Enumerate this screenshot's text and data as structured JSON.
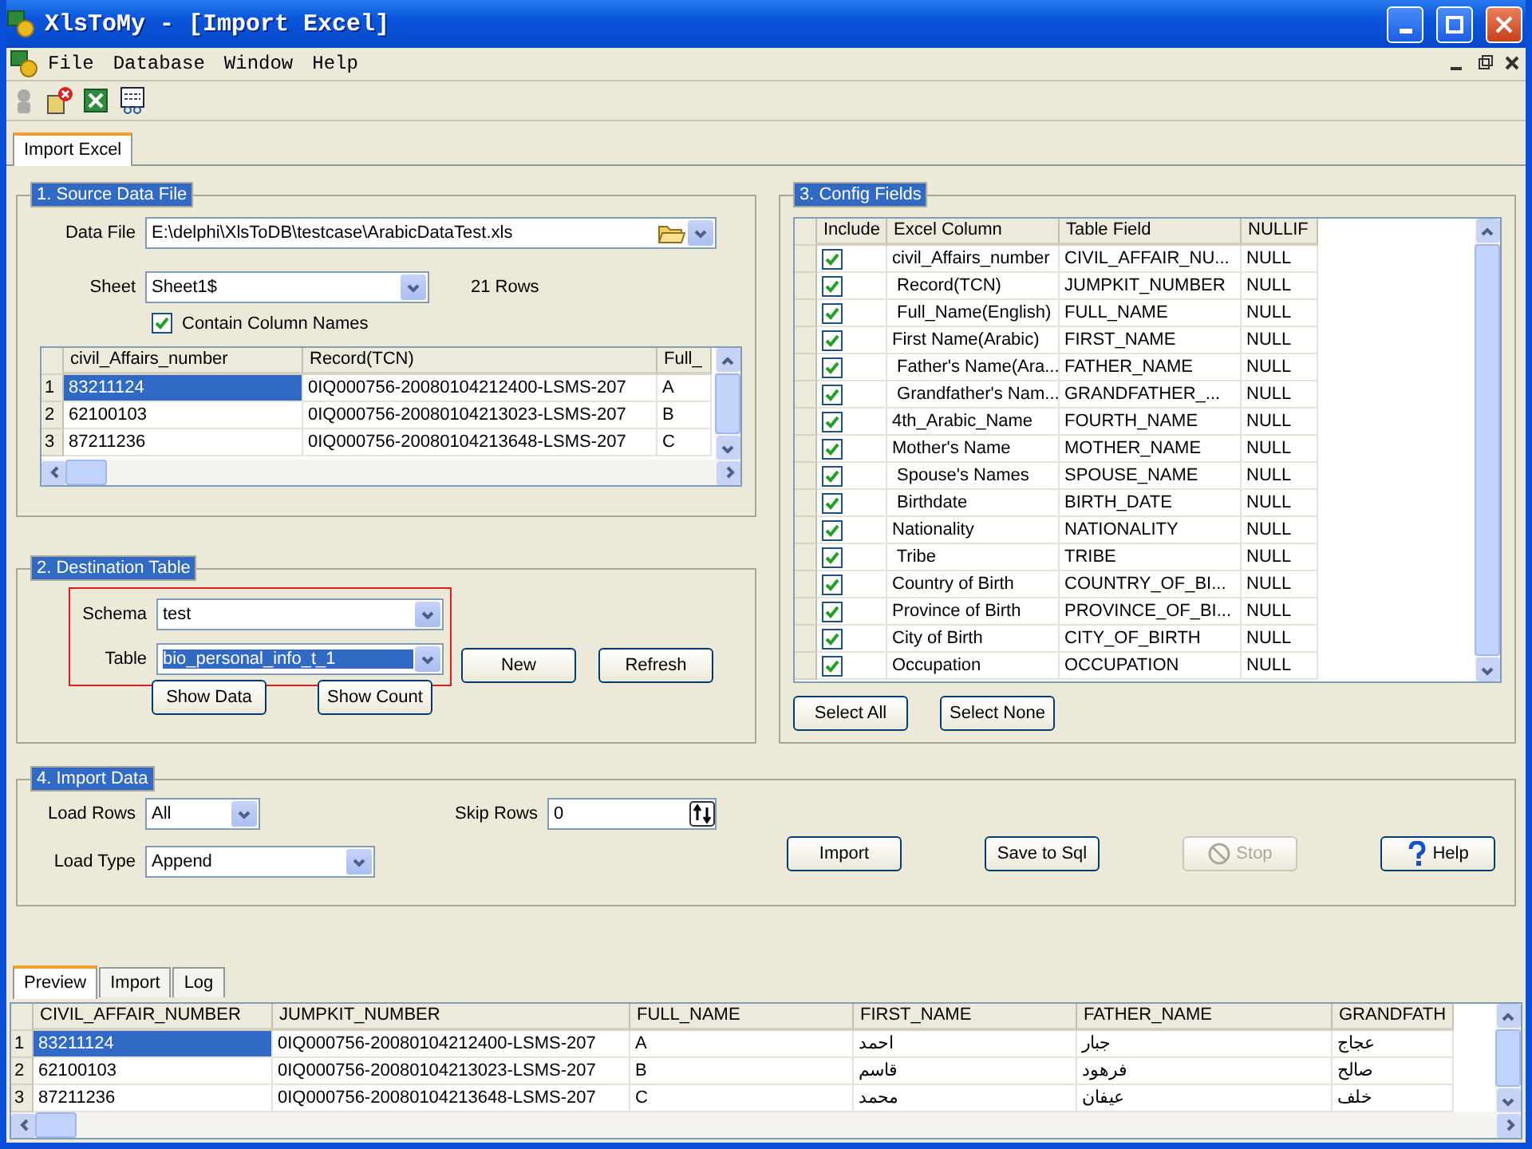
{
  "window": {
    "title": "XlsToMy - [Import Excel]"
  },
  "menu": [
    "File",
    "Database",
    "Window",
    "Help"
  ],
  "tabs": [
    {
      "label": "Import Excel",
      "selected": true
    }
  ],
  "source": {
    "legend": "1. Source Data File",
    "data_file": {
      "label": "Data File",
      "value": "E:\\delphi\\XlsToDB\\testcase\\ArabicDataTest.xls"
    },
    "sheet": {
      "label": "Sheet",
      "value": "Sheet1$"
    },
    "row_count": "21 Rows",
    "contain_names": {
      "label": "Contain Column Names",
      "checked": true
    },
    "grid": {
      "columns": [
        "civil_Affairs_number",
        "Record(TCN)",
        "Full_"
      ],
      "rows": [
        {
          "num": "1",
          "cells": [
            "83211124",
            "0IQ000756-20080104212400-LSMS-207",
            "A"
          ],
          "selected": true
        },
        {
          "num": "2",
          "cells": [
            "62100103",
            "0IQ000756-20080104213023-LSMS-207",
            "B"
          ],
          "selected": false
        },
        {
          "num": "3",
          "cells": [
            "87211236",
            "0IQ000756-20080104213648-LSMS-207",
            "C"
          ],
          "selected": false
        }
      ]
    }
  },
  "destination": {
    "legend": "2. Destination Table",
    "schema": {
      "label": "Schema",
      "value": "test"
    },
    "table": {
      "label": "Table",
      "value": "bio_personal_info_t_1",
      "selected": true
    },
    "buttons": [
      "New",
      "Refresh",
      "Show Data",
      "Show Count"
    ]
  },
  "config": {
    "legend": "3. Config Fields",
    "columns": [
      "Include",
      "Excel Column",
      "Table Field",
      "NULLIF"
    ],
    "rows": [
      {
        "included": true,
        "excel": "civil_Affairs_number",
        "field": "CIVIL_AFFAIR_NU...",
        "nullif": "NULL"
      },
      {
        "included": true,
        "excel": " Record(TCN)",
        "field": "JUMPKIT_NUMBER",
        "nullif": "NULL"
      },
      {
        "included": true,
        "excel": " Full_Name(English)",
        "field": "FULL_NAME",
        "nullif": "NULL"
      },
      {
        "included": true,
        "excel": "First Name(Arabic)",
        "field": "FIRST_NAME",
        "nullif": "NULL"
      },
      {
        "included": true,
        "excel": " Father's Name(Ara...",
        "field": "FATHER_NAME",
        "nullif": "NULL"
      },
      {
        "included": true,
        "excel": " Grandfather's Nam...",
        "field": "GRANDFATHER_...",
        "nullif": "NULL"
      },
      {
        "included": true,
        "excel": "4th_Arabic_Name",
        "field": "FOURTH_NAME",
        "nullif": "NULL"
      },
      {
        "included": true,
        "excel": "Mother's Name",
        "field": "MOTHER_NAME",
        "nullif": "NULL"
      },
      {
        "included": true,
        "excel": " Spouse's Names",
        "field": "SPOUSE_NAME",
        "nullif": "NULL"
      },
      {
        "included": true,
        "excel": " Birthdate",
        "field": "BIRTH_DATE",
        "nullif": "NULL"
      },
      {
        "included": true,
        "excel": "Nationality",
        "field": "NATIONALITY",
        "nullif": "NULL"
      },
      {
        "included": true,
        "excel": " Tribe",
        "field": "TRIBE",
        "nullif": "NULL"
      },
      {
        "included": true,
        "excel": "Country of Birth",
        "field": "COUNTRY_OF_BI...",
        "nullif": "NULL"
      },
      {
        "included": true,
        "excel": "Province of Birth",
        "field": "PROVINCE_OF_BI...",
        "nullif": "NULL"
      },
      {
        "included": true,
        "excel": "City of Birth",
        "field": "CITY_OF_BIRTH",
        "nullif": "NULL"
      },
      {
        "included": true,
        "excel": "Occupation",
        "field": "OCCUPATION",
        "nullif": "NULL"
      }
    ],
    "buttons": [
      "Select All",
      "Select None"
    ]
  },
  "import": {
    "legend": "4. Import Data",
    "load_rows": {
      "label": "Load Rows",
      "value": "All"
    },
    "load_type": {
      "label": "Load Type",
      "value": "Append"
    },
    "skip_rows": {
      "label": "Skip Rows",
      "value": "0"
    },
    "buttons": [
      {
        "label": "Import",
        "kind": "plain",
        "disabled": false
      },
      {
        "label": "Save to Sql",
        "kind": "plain",
        "disabled": false
      },
      {
        "label": "Stop",
        "kind": "stop",
        "disabled": true
      },
      {
        "label": "Help",
        "kind": "help",
        "disabled": false
      }
    ]
  },
  "bottom_tabs": [
    {
      "label": "Preview",
      "selected": true
    },
    {
      "label": "Import",
      "selected": false
    },
    {
      "label": "Log",
      "selected": false
    }
  ],
  "preview": {
    "columns": [
      "CIVIL_AFFAIR_NUMBER",
      "JUMPKIT_NUMBER",
      "FULL_NAME",
      "FIRST_NAME",
      "FATHER_NAME",
      "GRANDFATH"
    ],
    "rows": [
      {
        "num": "1",
        "cells": [
          "83211124",
          "0IQ000756-20080104212400-LSMS-207",
          "A",
          "احمد",
          "جبار",
          "عجاج"
        ],
        "selected": true
      },
      {
        "num": "2",
        "cells": [
          "62100103",
          "0IQ000756-20080104213023-LSMS-207",
          "B",
          "قاسم",
          "فرهود",
          "صالح"
        ],
        "selected": false
      },
      {
        "num": "3",
        "cells": [
          "87211236",
          "0IQ000756-20080104213648-LSMS-207",
          "C",
          "محمد",
          "عيفان",
          "خلف"
        ],
        "selected": false
      }
    ]
  }
}
